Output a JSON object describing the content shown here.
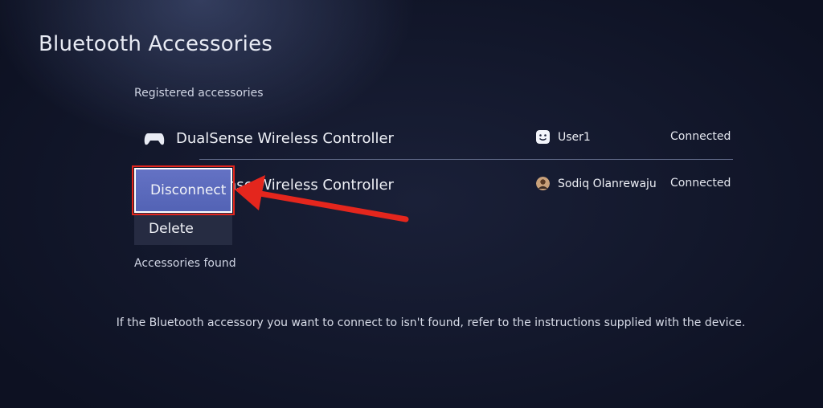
{
  "page": {
    "title": "Bluetooth Accessories"
  },
  "registered": {
    "heading": "Registered accessories",
    "devices": [
      {
        "name": "DualSense Wireless Controller",
        "user": "User1",
        "status": "Connected"
      },
      {
        "name": "DualSense Wireless Controller",
        "user": "Sodiq Olanrewaju",
        "status": "Connected"
      }
    ]
  },
  "context_menu": {
    "disconnect_label": "Disconnect",
    "delete_label": "Delete"
  },
  "found": {
    "heading": "Accessories found"
  },
  "footer": {
    "note": "If the Bluetooth accessory you want to connect to isn't found, refer to the instructions supplied with the device."
  },
  "colors": {
    "accent": "#5a69bd",
    "highlight": "#e4261d"
  },
  "icons": {
    "controller": "gamepad-icon",
    "user1_avatar": "smiley-avatar-icon",
    "user2_avatar": "photo-avatar-icon",
    "annotation": "red-arrow-icon"
  }
}
